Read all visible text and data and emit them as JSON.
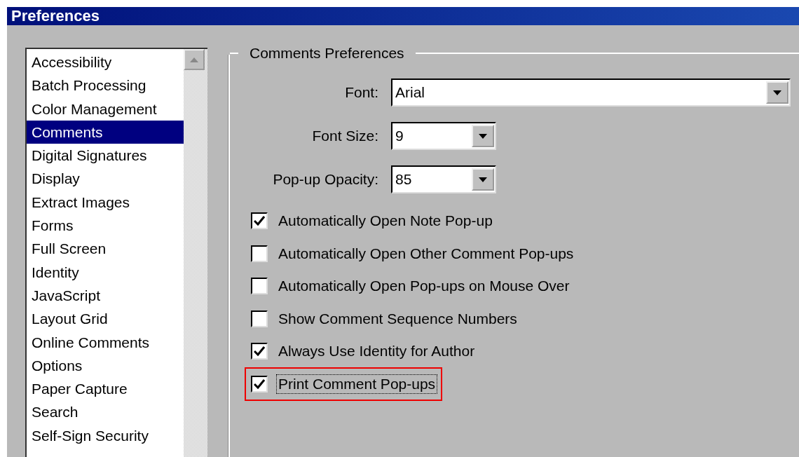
{
  "window": {
    "title": "Preferences"
  },
  "sidebar": {
    "items": [
      {
        "label": "Accessibility",
        "selected": false
      },
      {
        "label": "Batch Processing",
        "selected": false
      },
      {
        "label": "Color Management",
        "selected": false
      },
      {
        "label": "Comments",
        "selected": true
      },
      {
        "label": "Digital Signatures",
        "selected": false
      },
      {
        "label": "Display",
        "selected": false
      },
      {
        "label": "Extract Images",
        "selected": false
      },
      {
        "label": "Forms",
        "selected": false
      },
      {
        "label": "Full Screen",
        "selected": false
      },
      {
        "label": "Identity",
        "selected": false
      },
      {
        "label": "JavaScript",
        "selected": false
      },
      {
        "label": "Layout Grid",
        "selected": false
      },
      {
        "label": "Online Comments",
        "selected": false
      },
      {
        "label": "Options",
        "selected": false
      },
      {
        "label": "Paper Capture",
        "selected": false
      },
      {
        "label": "Search",
        "selected": false
      },
      {
        "label": "Self-Sign Security",
        "selected": false
      }
    ]
  },
  "group": {
    "title": "Comments Preferences",
    "fields": [
      {
        "label": "Font:",
        "value": "Arial",
        "kind": "wide"
      },
      {
        "label": "Font Size:",
        "value": "9",
        "kind": "narrow"
      },
      {
        "label": "Pop-up Opacity:",
        "value": "85",
        "kind": "narrow"
      }
    ],
    "options": [
      {
        "label": "Automatically Open Note Pop-up",
        "checked": true,
        "focused": false,
        "highlighted": false
      },
      {
        "label": "Automatically Open Other Comment Pop-ups",
        "checked": false,
        "focused": false,
        "highlighted": false
      },
      {
        "label": "Automatically Open Pop-ups on Mouse Over",
        "checked": false,
        "focused": false,
        "highlighted": false
      },
      {
        "label": "Show Comment Sequence Numbers",
        "checked": false,
        "focused": false,
        "highlighted": false
      },
      {
        "label": "Always Use Identity for Author",
        "checked": true,
        "focused": false,
        "highlighted": false
      },
      {
        "label": "Print Comment Pop-ups",
        "checked": true,
        "focused": true,
        "highlighted": true
      }
    ]
  }
}
